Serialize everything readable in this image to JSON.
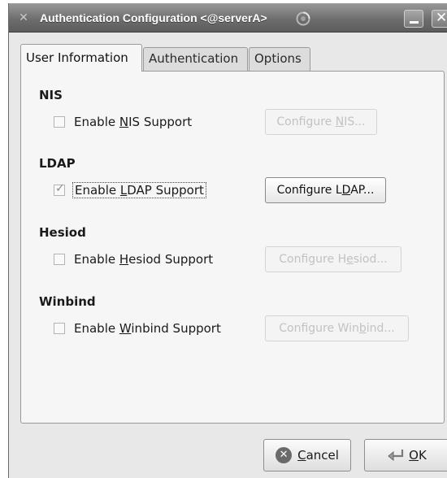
{
  "window": {
    "title": "Authentication Configuration <@serverA>"
  },
  "tabs": [
    {
      "label": "User Information",
      "active": true
    },
    {
      "label": "Authentication",
      "active": false
    },
    {
      "label": "Options",
      "active": false
    }
  ],
  "sections": {
    "nis": {
      "heading": "NIS",
      "check_pre": "Enable ",
      "check_key": "N",
      "check_post": "IS Support",
      "checked": false,
      "btn_pre": "Configure ",
      "btn_key": "N",
      "btn_post": "IS...",
      "btn_enabled": false
    },
    "ldap": {
      "heading": "LDAP",
      "check_pre": "Enable ",
      "check_key": "L",
      "check_post": "DAP Support",
      "checked": true,
      "btn_pre": "Configure L",
      "btn_key": "D",
      "btn_post": "AP...",
      "btn_enabled": true
    },
    "hesiod": {
      "heading": "Hesiod",
      "check_pre": "Enable ",
      "check_key": "H",
      "check_post": "esiod Support",
      "checked": false,
      "btn_pre": "Configure H",
      "btn_key": "e",
      "btn_post": "siod...",
      "btn_enabled": false
    },
    "winbind": {
      "heading": "Winbind",
      "check_pre": "Enable ",
      "check_key": "W",
      "check_post": "inbind Support",
      "checked": false,
      "btn_pre": "Configure Win",
      "btn_key": "b",
      "btn_post": "ind...",
      "btn_enabled": false
    }
  },
  "buttons": {
    "cancel_key": "C",
    "cancel_post": "ancel",
    "ok_key": "O",
    "ok_post": "K"
  },
  "icons": {
    "window_menu": "window-menu-icon",
    "busy": "busy-spinner-icon",
    "minimize": "minimize-icon",
    "close": "close-icon",
    "cancel": "cancel-icon",
    "ok": "ok-arrow-icon"
  }
}
